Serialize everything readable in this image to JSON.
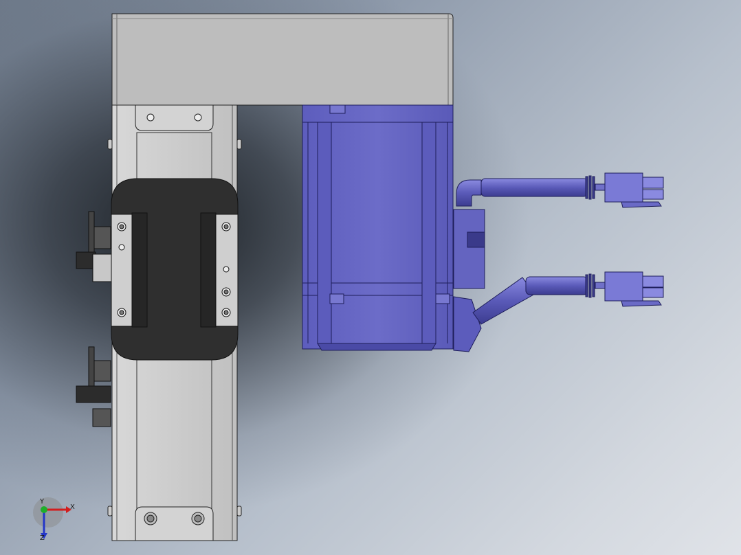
{
  "viewport": {
    "view": "top",
    "background_colors": [
      "#6f7b8b",
      "#b7c0cc",
      "#e0e3e8"
    ]
  },
  "model": {
    "actuator_color": "#c6c6c6",
    "actuator_cap_color": "#bdbdbd",
    "motor_color": "#6b6bc4",
    "motor_edge_color": "#2a2a6a",
    "carriage_color": "#2f2f2f"
  },
  "triad": {
    "x_label": "X",
    "y_label": "Y",
    "z_label": "Z",
    "x_color": "#d21e1e",
    "y_color": "#1fae2a",
    "z_color": "#2436c8"
  }
}
